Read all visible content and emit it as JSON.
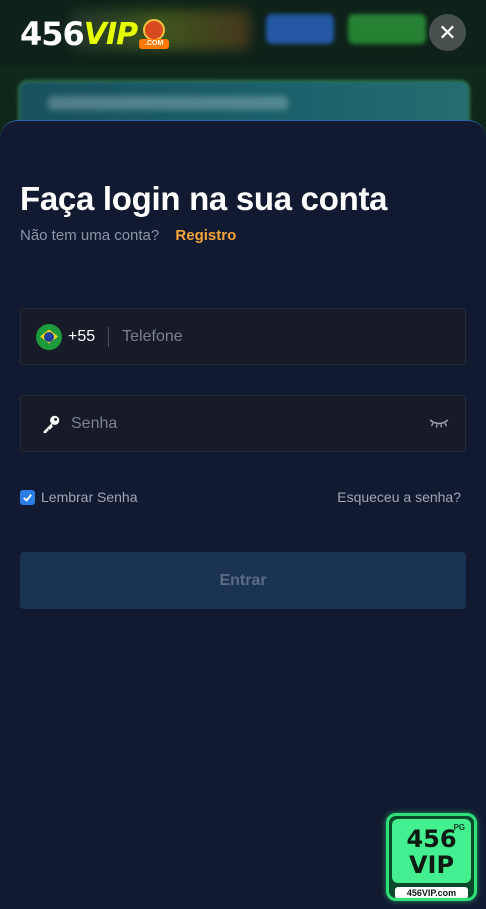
{
  "header": {
    "logo_number": "456",
    "logo_vip": "VIP",
    "logo_tag": ".COM",
    "close_label": "✕"
  },
  "login": {
    "title": "Faça login na sua conta",
    "no_account": "Não tem uma conta?",
    "register_link": "Registro",
    "phone": {
      "country_code": "+55",
      "placeholder": "Telefone",
      "value": ""
    },
    "password": {
      "placeholder": "Senha",
      "value": ""
    },
    "remember_label": "Lembrar Senha",
    "remember_checked": true,
    "forgot_label": "Esqueceu a senha?",
    "submit_label": "Entrar"
  },
  "badge": {
    "pg": "PG",
    "line1": "456",
    "line2": "VIP",
    "url": "456VIP.com"
  },
  "colors": {
    "sheet_bg": "#121a31",
    "accent_orange": "#f3a43a",
    "checkbox_blue": "#2a7ee6",
    "submit_bg": "#1a3352",
    "logo_yellow": "#e6ff00",
    "badge_green": "#43ef8e"
  },
  "icons": {
    "flag": "brazil-flag-icon",
    "password": "key-icon",
    "visibility": "eye-closed-icon",
    "close": "close-icon",
    "checkbox": "check-icon"
  }
}
